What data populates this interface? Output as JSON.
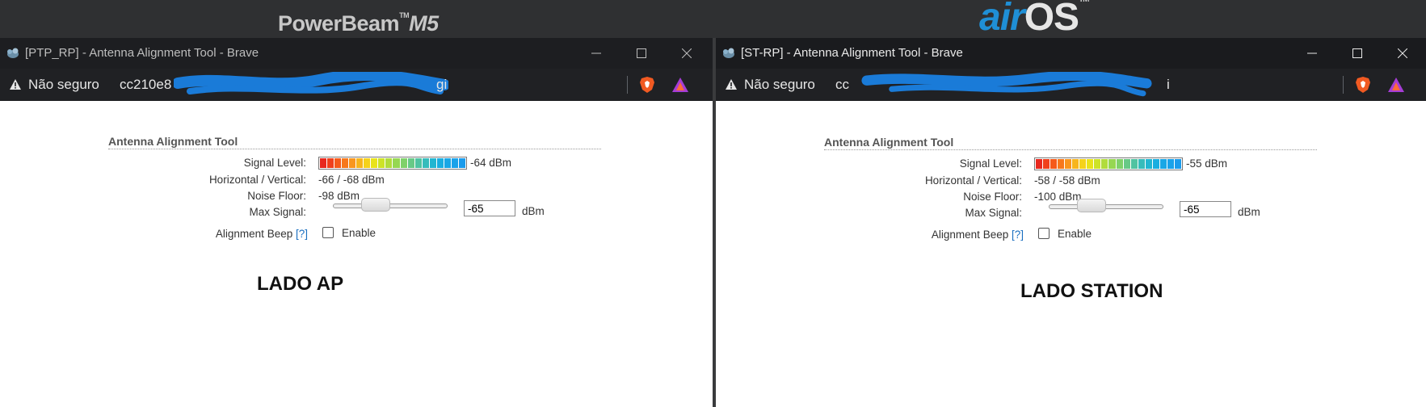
{
  "desktop": {
    "brand_left_main": "PowerBeam",
    "brand_left_tm": "TM",
    "brand_left_model": "M5",
    "brand_right_air": "air",
    "brand_right_os": "OS",
    "brand_right_tm": "TM"
  },
  "left_window": {
    "title": "[PTP_RP] - Antenna Alignment Tool - Brave",
    "not_secure": "Não seguro",
    "url_visible": "cc210e8",
    "url_tail": "gi",
    "tool_title": "Antenna Alignment Tool",
    "signal_level_label": "Signal Level:",
    "signal_level_value": "-64 dBm",
    "hv_label": "Horizontal / Vertical:",
    "hv_value": "-66 / -68 dBm",
    "noise_label": "Noise Floor:",
    "noise_value": "-98 dBm",
    "max_signal_label": "Max Signal:",
    "max_signal_input": "-65",
    "max_signal_unit": "dBm",
    "beep_label": "Alignment Beep",
    "beep_help": "[?]",
    "enable_label": "Enable",
    "side_label": "LADO AP"
  },
  "right_window": {
    "title": "[ST-RP] - Antenna Alignment Tool - Brave",
    "not_secure": "Não seguro",
    "url_visible": "cc",
    "url_tail": "i",
    "tool_title": "Antenna Alignment Tool",
    "signal_level_label": "Signal Level:",
    "signal_level_value": "-55 dBm",
    "hv_label": "Horizontal / Vertical:",
    "hv_value": "-58 / -58 dBm",
    "noise_label": "Noise Floor:",
    "noise_value": "-100 dBm",
    "max_signal_label": "Max Signal:",
    "max_signal_input": "-65",
    "max_signal_unit": "dBm",
    "beep_label": "Alignment Beep",
    "beep_help": "[?]",
    "enable_label": "Enable",
    "side_label": "LADO STATION"
  },
  "meter_colors": [
    "#e8281e",
    "#f0401c",
    "#f55a1a",
    "#f7781c",
    "#f9961e",
    "#f7b51d",
    "#f5d21b",
    "#e9e31b",
    "#cde327",
    "#b1dc3c",
    "#96d752",
    "#7fd16a",
    "#67c986",
    "#4fc3a1",
    "#36bcbb",
    "#22b6d1",
    "#1aaee0",
    "#19a7e6",
    "#1aa2ea",
    "#1b9cec"
  ],
  "colors": {
    "accent_blue": "#1f8fd6",
    "scribble": "#1a7bd8"
  }
}
